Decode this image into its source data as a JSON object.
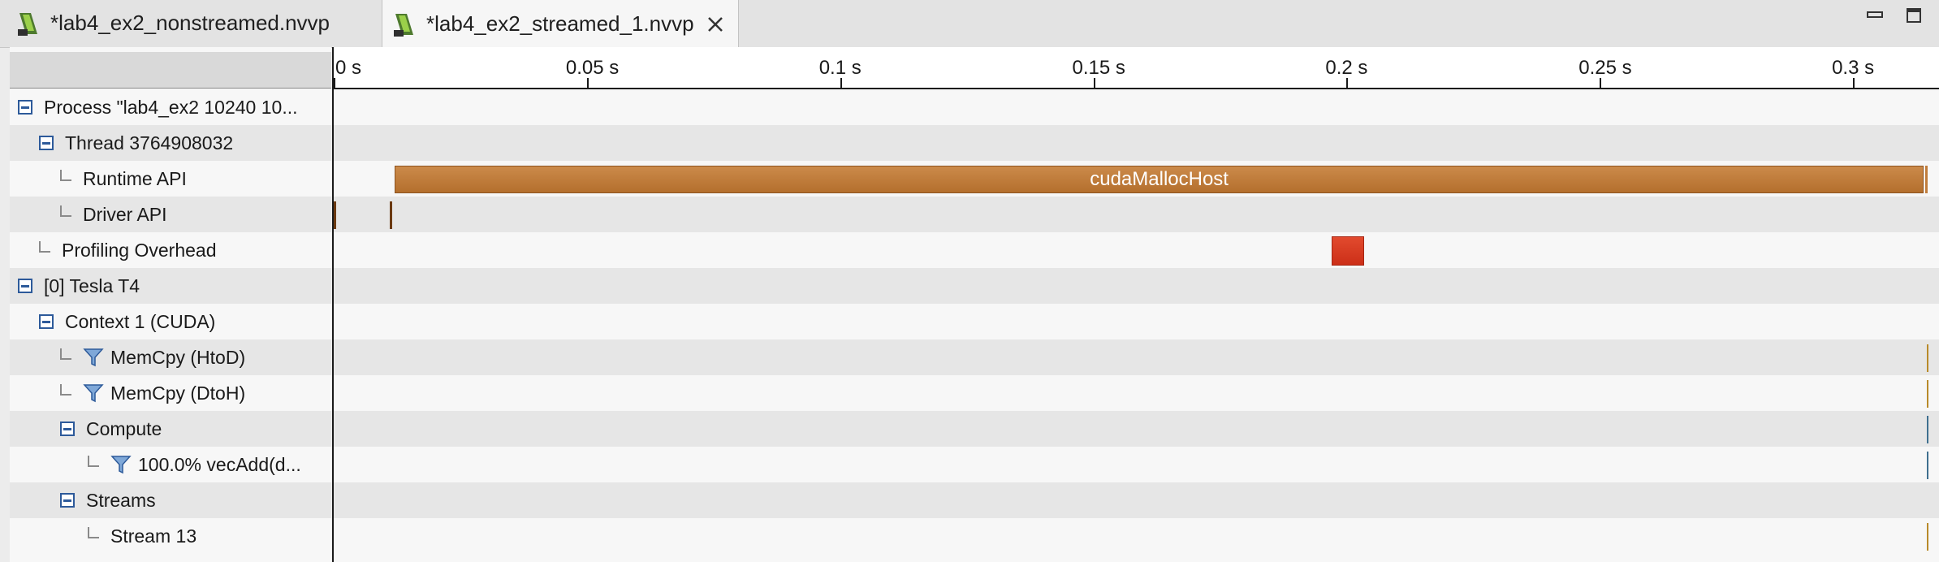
{
  "tabs": [
    {
      "label": "*lab4_ex2_nonstreamed.nvvp",
      "active": false
    },
    {
      "label": "*lab4_ex2_streamed_1.nvvp",
      "active": true
    }
  ],
  "tree": {
    "rows": [
      {
        "label": "Process \"lab4_ex2 10240 10...",
        "control": "collapse"
      },
      {
        "label": "Thread 3764908032",
        "control": "collapse"
      },
      {
        "label": "Runtime API",
        "control": "connector"
      },
      {
        "label": "Driver API",
        "control": "connector"
      },
      {
        "label": "Profiling Overhead",
        "control": "connector"
      },
      {
        "label": "[0] Tesla T4",
        "control": "collapse"
      },
      {
        "label": "Context 1 (CUDA)",
        "control": "collapse"
      },
      {
        "label": "MemCpy (HtoD)",
        "control": "connector-filter"
      },
      {
        "label": "MemCpy (DtoH)",
        "control": "connector-filter"
      },
      {
        "label": "Compute",
        "control": "collapse"
      },
      {
        "label": "100.0% vecAdd(d...",
        "control": "connector-filter"
      },
      {
        "label": "Streams",
        "control": "collapse"
      },
      {
        "label": "Stream 13",
        "control": "connector"
      }
    ]
  },
  "timeline": {
    "ticks": [
      "0 s",
      "0.05 s",
      "0.1 s",
      "0.15 s",
      "0.2 s",
      "0.25 s",
      "0.3 s"
    ],
    "tick_values_s": [
      0,
      0.05,
      0.1,
      0.15,
      0.2,
      0.25,
      0.3
    ],
    "events": {
      "runtime_api": {
        "name": "cudaMallocHost",
        "start_s": 0.012,
        "end_s": 0.314
      },
      "driver_api_markers_s": [
        0.0,
        0.011
      ],
      "profiling_overhead": {
        "start_s": 0.197,
        "end_s": 0.2035
      },
      "tail_markers_s": 0.3145
    },
    "colors": {
      "runtime_api": "#c07d3c",
      "profiling_overhead": "#d83a22",
      "driver_api": "#6b3a12",
      "memcpy_marker": "#b88a2a",
      "compute_marker": "#3f6f8f"
    }
  },
  "icons": {
    "tab_icon": "nvvp-file-icon",
    "close_icon": "close-icon",
    "filter_icon": "filter-funnel-icon"
  }
}
